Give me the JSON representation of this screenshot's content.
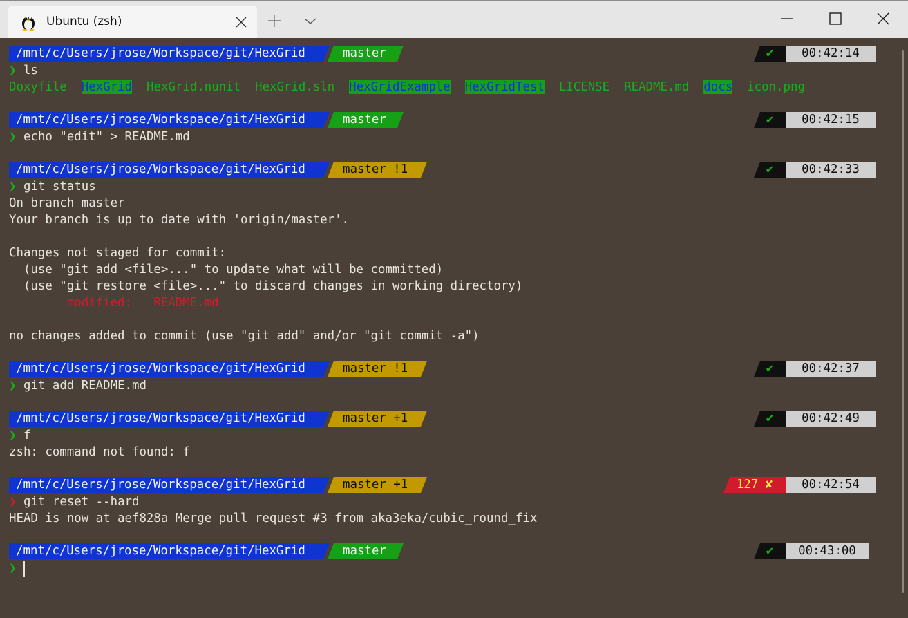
{
  "titlebar": {
    "tab_title": "Ubuntu (zsh)",
    "icons": [
      "tux-icon",
      "close-tab-icon",
      "new-tab-icon",
      "dropdown-icon",
      "minimize-icon",
      "maximize-icon",
      "close-window-icon"
    ]
  },
  "colors": {
    "path_bg": "#1034d0",
    "git_clean_bg": "#16a016",
    "git_dirty_bg": "#c29a00",
    "status_ok_bg": "#101010",
    "status_err_bg": "#d01b2d",
    "time_bg": "#d0d0d0"
  },
  "prompts": [
    {
      "path": "/mnt/c/Users/jrose/Workspace/git/HexGrid",
      "git": "master",
      "status": "✔",
      "time": "00:42:14",
      "cmd": "ls"
    },
    {
      "path": "/mnt/c/Users/jrose/Workspace/git/HexGrid",
      "git": "master",
      "status": "✔",
      "time": "00:42:15",
      "cmd": "echo \"edit\" > README.md"
    },
    {
      "path": "/mnt/c/Users/jrose/Workspace/git/HexGrid",
      "git": "master !1",
      "status": "✔",
      "time": "00:42:33",
      "cmd": "git status"
    },
    {
      "path": "/mnt/c/Users/jrose/Workspace/git/HexGrid",
      "git": "master !1",
      "status": "✔",
      "time": "00:42:37",
      "cmd": "git add README.md"
    },
    {
      "path": "/mnt/c/Users/jrose/Workspace/git/HexGrid",
      "git": "master +1",
      "status": "✔",
      "time": "00:42:49",
      "cmd": "f"
    },
    {
      "path": "/mnt/c/Users/jrose/Workspace/git/HexGrid",
      "git": "master +1",
      "status": "127 ✘",
      "time": "00:42:54",
      "cmd": "git reset --hard"
    },
    {
      "path": "/mnt/c/Users/jrose/Workspace/git/HexGrid",
      "git": "master",
      "status": "✔",
      "time": "00:43:00",
      "cmd": ""
    }
  ],
  "prompt_char": "❯",
  "ls_output": [
    {
      "name": "Doxyfile"
    },
    {
      "name": "HexGrid"
    },
    {
      "name": "HexGrid.nunit"
    },
    {
      "name": "HexGrid.sln"
    },
    {
      "name": "HexGridExample"
    },
    {
      "name": "HexGridTest"
    },
    {
      "name": "LICENSE"
    },
    {
      "name": "README.md"
    },
    {
      "name": "docs"
    },
    {
      "name": "icon.png"
    }
  ],
  "git_status_output": {
    "l1": "On branch master",
    "l2": "Your branch is up to date with 'origin/master'.",
    "l3": "Changes not staged for commit:",
    "l4": "  (use \"git add <file>...\" to update what will be committed)",
    "l5": "  (use \"git restore <file>...\" to discard changes in working directory)",
    "l6": "        modified:   README.md",
    "l7": "no changes added to commit (use \"git add\" and/or \"git commit -a\")"
  },
  "f_output": "zsh: command not found: f",
  "reset_output": "HEAD is now at aef828a Merge pull request #3 from aka3eka/cubic_round_fix"
}
